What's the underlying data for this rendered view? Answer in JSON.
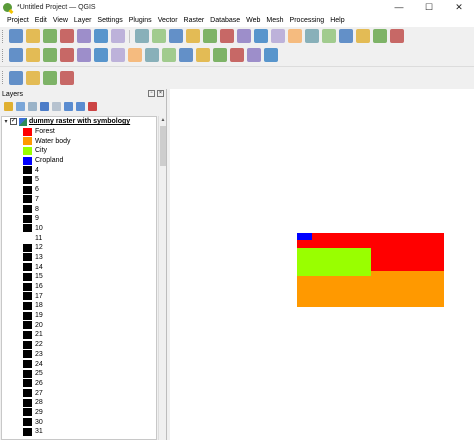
{
  "window": {
    "title": "*Untitled Project — QGIS",
    "controls": {
      "minimize": "—",
      "maximize": "☐",
      "close": "✕"
    }
  },
  "menu": [
    "Project",
    "Edit",
    "View",
    "Layer",
    "Settings",
    "Plugins",
    "Vector",
    "Raster",
    "Database",
    "Web",
    "Mesh",
    "Processing",
    "Help"
  ],
  "toolbar1_icons": [
    "new-project",
    "open-project",
    "save-project",
    "save-as",
    "new-print-layout",
    "show-layout-manager",
    "style-manager",
    "sep",
    "pan-map",
    "pan-to-selection",
    "zoom-in",
    "zoom-out",
    "zoom-full",
    "zoom-to-selection",
    "zoom-to-layer",
    "zoom-native",
    "zoom-last",
    "zoom-next",
    "new-map-view",
    "new-3d-map-view",
    "temporal-controller",
    "refresh",
    "identify",
    "select-features"
  ],
  "toolbar2_icons": [
    "open-attribute-table",
    "field-calculator",
    "statistical-summary",
    "digitize-toggle",
    "save-edits",
    "digitize-polygon",
    "vertex-tool",
    "delete-selected",
    "cut-features",
    "copy-features",
    "paste-features",
    "undo",
    "redo",
    "label-toolbar",
    "python-console",
    "plugins-manager"
  ],
  "toolbar3_icons": [
    "annotation-tool",
    "measure-tool",
    "map-tips",
    "text-annotation"
  ],
  "layers_panel": {
    "title": "Layers",
    "layer": {
      "name": "dummy raster with symbology",
      "checked": true,
      "expanded": true
    },
    "legend": [
      {
        "label": "Forest",
        "color": "#ff0000"
      },
      {
        "label": "Water body",
        "color": "#ff9900"
      },
      {
        "label": "City",
        "color": "#99ff00"
      },
      {
        "label": "Cropland",
        "color": "#0000ff"
      },
      {
        "label": "4",
        "color": "#000000"
      },
      {
        "label": "5",
        "color": "#000000"
      },
      {
        "label": "6",
        "color": "#000000"
      },
      {
        "label": "7",
        "color": "#000000"
      },
      {
        "label": "8",
        "color": "#000000"
      },
      {
        "label": "9",
        "color": "#000000"
      },
      {
        "label": "10",
        "color": "#000000"
      },
      {
        "label": "11",
        "color": "#ffffff"
      },
      {
        "label": "12",
        "color": "#000000"
      },
      {
        "label": "13",
        "color": "#000000"
      },
      {
        "label": "14",
        "color": "#000000"
      },
      {
        "label": "15",
        "color": "#000000"
      },
      {
        "label": "16",
        "color": "#000000"
      },
      {
        "label": "17",
        "color": "#000000"
      },
      {
        "label": "18",
        "color": "#000000"
      },
      {
        "label": "19",
        "color": "#000000"
      },
      {
        "label": "20",
        "color": "#000000"
      },
      {
        "label": "21",
        "color": "#000000"
      },
      {
        "label": "22",
        "color": "#000000"
      },
      {
        "label": "23",
        "color": "#000000"
      },
      {
        "label": "24",
        "color": "#000000"
      },
      {
        "label": "25",
        "color": "#000000"
      },
      {
        "label": "26",
        "color": "#000000"
      },
      {
        "label": "27",
        "color": "#000000"
      },
      {
        "label": "28",
        "color": "#000000"
      },
      {
        "label": "29",
        "color": "#000000"
      },
      {
        "label": "30",
        "color": "#000000"
      },
      {
        "label": "31",
        "color": "#000000"
      }
    ]
  },
  "map": {
    "background": "#ffffff",
    "colors": {
      "forest": "#ff0000",
      "water": "#ff9900",
      "city": "#99ff00",
      "cropland": "#0000ff"
    }
  }
}
